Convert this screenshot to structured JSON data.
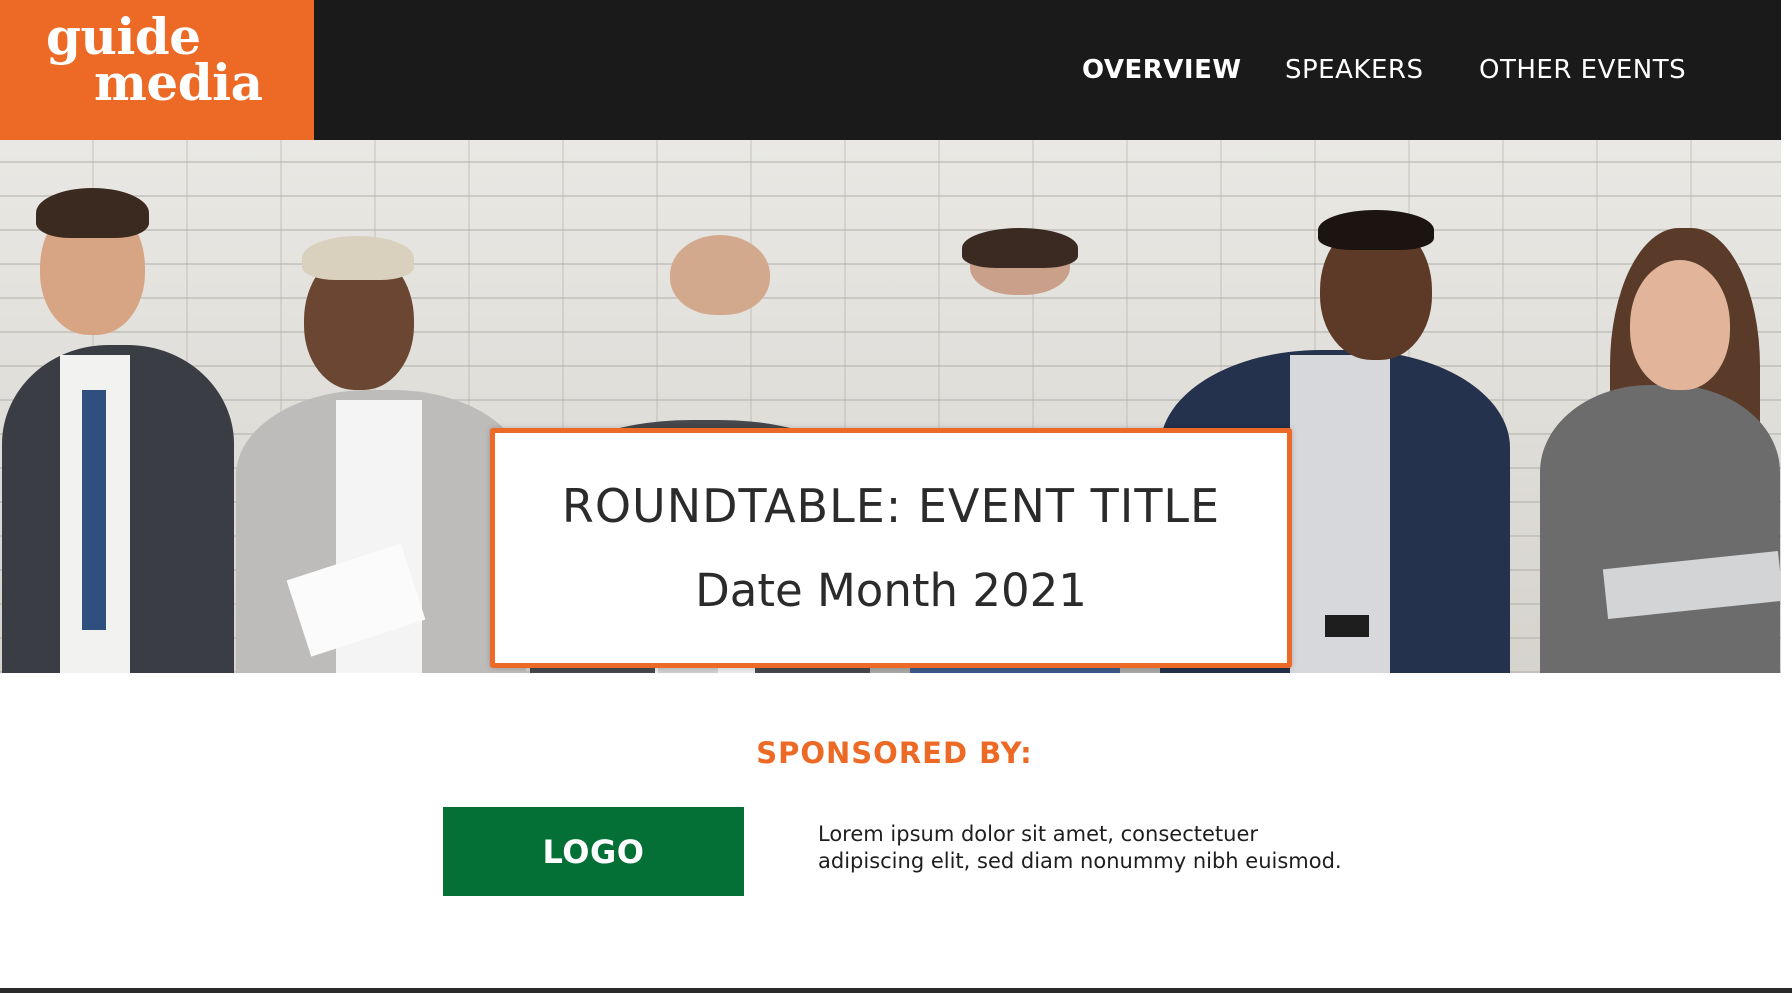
{
  "brand": {
    "logo_line1": "guide",
    "logo_line2": "media",
    "accent_color": "#ec6a25",
    "header_bg": "#1a1a1a"
  },
  "nav": {
    "items": [
      {
        "label": "OVERVIEW",
        "active": true
      },
      {
        "label": "SPEAKERS",
        "active": false
      },
      {
        "label": "OTHER EVENTS",
        "active": false
      }
    ]
  },
  "hero": {
    "image": "people-seated-against-white-brick-wall",
    "title": "ROUNDTABLE: EVENT TITLE",
    "date": "Date Month 2021"
  },
  "sponsor": {
    "heading": "SPONSORED BY:",
    "logo_label": "LOGO",
    "logo_color": "#047036",
    "description_line1": "Lorem ipsum dolor sit amet, consectetuer",
    "description_line2": "adipiscing elit, sed diam nonummy nibh euismod."
  }
}
